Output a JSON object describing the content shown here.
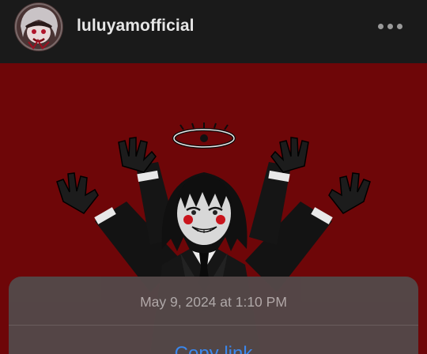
{
  "header": {
    "username": "luluyamofficial",
    "avatar_icon": "profile-avatar",
    "more_icon": "more-options-icon"
  },
  "post": {
    "image_description_icon": "illustration-image",
    "background_color": "#6e0608"
  },
  "action_sheet": {
    "timestamp": "May 9, 2024 at 1:10 PM",
    "copy_link_label": "Copy link",
    "accent_color": "#3c8bf4"
  }
}
